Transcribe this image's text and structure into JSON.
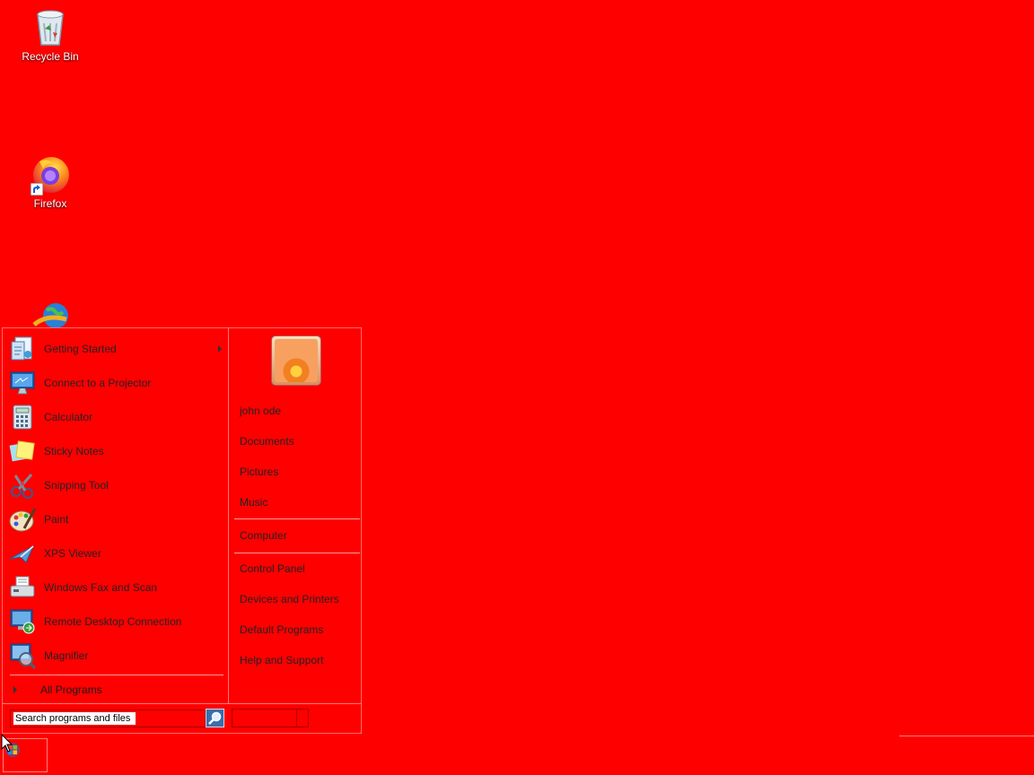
{
  "desktop": {
    "icons": [
      {
        "label": "Recycle Bin",
        "icon": "recycle-bin-icon"
      },
      {
        "label": "Firefox",
        "icon": "firefox-icon"
      },
      {
        "label": "",
        "icon": "internet-download-icon"
      }
    ],
    "background_color": "#ff0000"
  },
  "start_menu": {
    "programs": [
      {
        "label": "Getting Started",
        "icon": "getting-started-icon",
        "has_submenu": true
      },
      {
        "label": "Connect to a Projector",
        "icon": "projector-icon"
      },
      {
        "label": "Calculator",
        "icon": "calculator-icon"
      },
      {
        "label": "Sticky Notes",
        "icon": "sticky-notes-icon"
      },
      {
        "label": "Snipping Tool",
        "icon": "snipping-tool-icon"
      },
      {
        "label": "Paint",
        "icon": "paint-icon"
      },
      {
        "label": "XPS Viewer",
        "icon": "xps-viewer-icon"
      },
      {
        "label": "Windows Fax and Scan",
        "icon": "fax-scan-icon"
      },
      {
        "label": "Remote Desktop Connection",
        "icon": "remote-desktop-icon"
      },
      {
        "label": "Magnifier",
        "icon": "magnifier-icon"
      }
    ],
    "all_programs": "All Programs",
    "places": [
      "john ode",
      "Documents",
      "Pictures",
      "Music",
      "Computer",
      "Control Panel",
      "Devices and Printers",
      "Default Programs",
      "Help and Support"
    ],
    "search": {
      "value": "Search programs and files"
    }
  }
}
